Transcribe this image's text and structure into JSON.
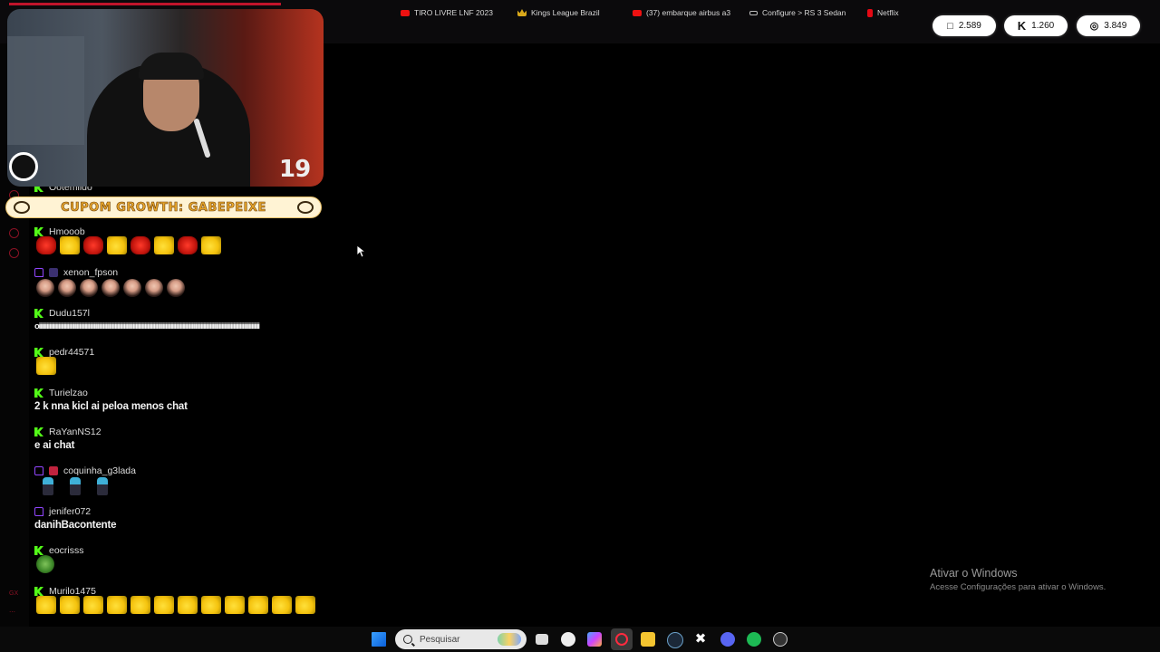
{
  "browser": {
    "bookmarks": [
      {
        "label": "TIRO LIVRE LNF 2023",
        "icon": "youtube-icon"
      },
      {
        "label": "Kings League Brazil",
        "icon": "crown-icon"
      },
      {
        "label": "(37) embarque airbus a3",
        "icon": "youtube-icon"
      },
      {
        "label": "Configure > RS 3 Sedan",
        "icon": "link-icon"
      },
      {
        "label": "Netflix",
        "icon": "netflix-icon"
      }
    ]
  },
  "counters": [
    {
      "platform": "twitch",
      "value": "2.589"
    },
    {
      "platform": "kick",
      "value": "1.260"
    },
    {
      "platform": "total",
      "value": "3.849"
    }
  ],
  "webcam": {
    "badge": "19"
  },
  "coupon": {
    "text": "CUPOM GROWTH: GABEPEIXE"
  },
  "chat": {
    "partial_user": "Ootemildo",
    "messages": [
      {
        "user": "Hmooob",
        "platform": "kick",
        "emotes": [
          "red",
          "ok",
          "red",
          "ok",
          "red",
          "ok",
          "red",
          "ok"
        ]
      },
      {
        "user": "xenon_fpson",
        "platform": "twitch",
        "emotes": [
          "girl",
          "girl",
          "girl",
          "girl",
          "girl",
          "girl",
          "girl"
        ]
      },
      {
        "user": "Dudu157l",
        "platform": "kick",
        "text": "oiiiiiiiiiiiiiiiiiiiiiiiiiiiiiiiiiiiiiiiiiiiiiiiiiiiiiiiiiiiiiiiiiiiiiiiiiiiiiiiiiiiiiiiiiiiiiiiiiiiiiiiiiiiiiiiiiiiiiiiiiiiiiiiiiiiiiiiiiiiiiiiiiiiiiiiiiiiiiiiiiiiiiiiii"
      },
      {
        "user": "pedr44571",
        "platform": "kick",
        "emotes": [
          "ok"
        ]
      },
      {
        "user": "Turielzao",
        "platform": "kick",
        "text": "2 k nna kicl ai peloa menos chat"
      },
      {
        "user": "RaYanNS12",
        "platform": "kick",
        "text": "e ai chat"
      },
      {
        "user": "coquinha_g3lada",
        "platform": "twitch",
        "emotes": [
          "fig",
          "fig",
          "fig"
        ]
      },
      {
        "user": "jenifer072",
        "platform": "twitch",
        "text": "danihBacontente"
      },
      {
        "user": "eocrisss",
        "platform": "kick",
        "emotes": [
          "pepe"
        ]
      },
      {
        "user": "Murilo1475",
        "platform": "kick",
        "emotes": [
          "ok",
          "ok",
          "ok",
          "ok",
          "ok",
          "ok",
          "ok",
          "ok",
          "ok",
          "ok",
          "ok",
          "ok"
        ]
      }
    ]
  },
  "watermark": {
    "title": "Ativar o Windows",
    "subtitle": "Acesse Configurações para ativar o Windows."
  },
  "taskbar": {
    "search_placeholder": "Pesquisar",
    "apps": [
      "windows-start-icon",
      "task-view-icon",
      "app-face-icon",
      "copilot-icon",
      "opera-icon",
      "file-explorer-icon",
      "steam-icon",
      "capcut-icon",
      "discord-icon",
      "spotify-icon",
      "obs-icon"
    ]
  },
  "colors": {
    "kick": "#53fc18",
    "twitch": "#9146ff",
    "accent": "#c0142b"
  }
}
